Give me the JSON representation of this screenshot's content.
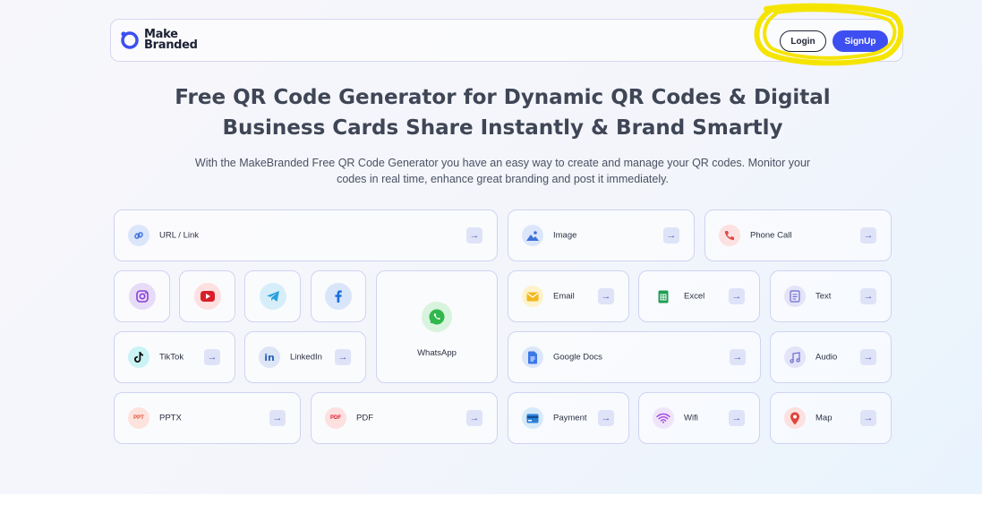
{
  "header": {
    "logo_line1": "Make",
    "logo_line2": "Branded",
    "login_label": "Login",
    "signup_label": "SignUp"
  },
  "hero": {
    "title_line1": "Free QR Code Generator for Dynamic QR Codes & Digital",
    "title_line2": "Business Cards Share Instantly & Brand Smartly",
    "subtitle_line1": "With the MakeBranded Free QR Code Generator you have an easy way to create and manage your QR codes. Monitor your",
    "subtitle_line2": "codes in real time, enhance great branding and post it immediately."
  },
  "options": {
    "url": "URL / Link",
    "image": "Image",
    "phone": "Phone Call",
    "email": "Email",
    "excel": "Excel",
    "text": "Text",
    "whatsapp": "WhatsApp",
    "tiktok": "TikTok",
    "linkedin": "LinkedIn",
    "google_docs": "Google Docs",
    "audio": "Audio",
    "pptx": "PPTX",
    "pdf": "PDF",
    "payment": "Payment",
    "wifi": "Wifi",
    "map": "Map",
    "pptx_icon_text": "PPT",
    "pdf_icon_text": "PDF",
    "linkedin_icon_text": "in"
  },
  "icons": {
    "arrow": "→"
  },
  "colors": {
    "primary": "#3d4ff0",
    "highlight": "#f5e400"
  }
}
